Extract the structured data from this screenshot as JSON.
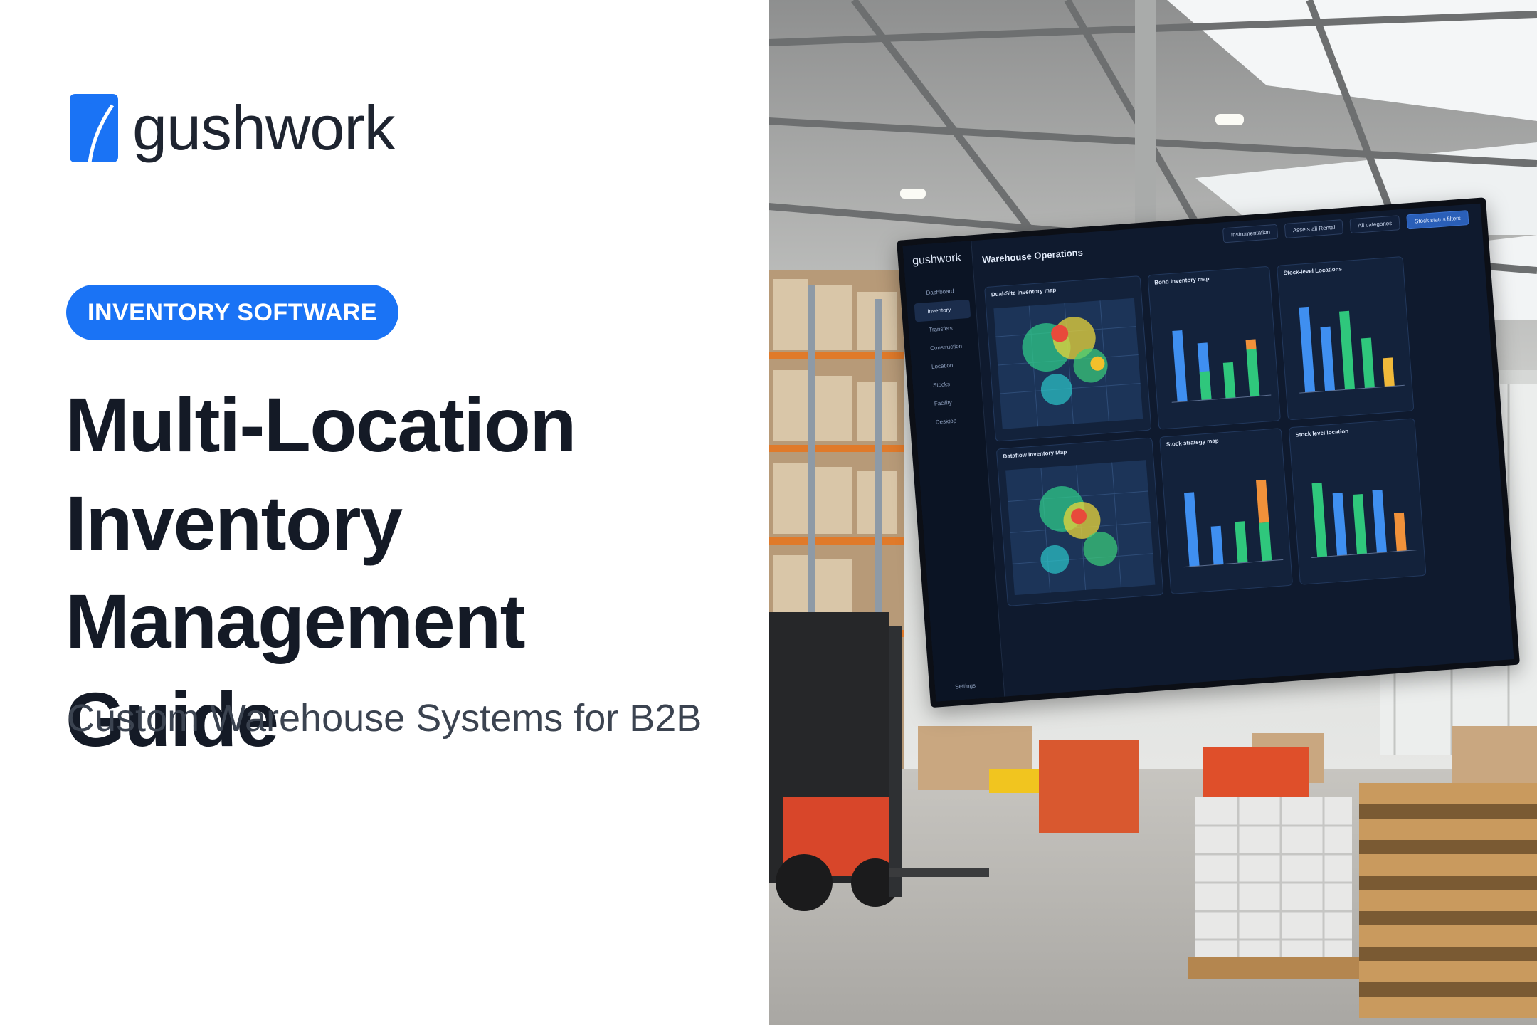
{
  "brand": {
    "name": "gushwork",
    "color": "#1a73f5"
  },
  "badge": {
    "label": "INVENTORY SOFTWARE"
  },
  "headline": {
    "line1": "Multi-Location",
    "line2": "Inventory",
    "line3": "Management Guide"
  },
  "subtitle": "Custom Warehouse Systems for B2B",
  "screen": {
    "logo": "gushwork",
    "title": "Warehouse Operations",
    "nav": [
      "Dashboard",
      "Inventory",
      "Transfers",
      "Construction",
      "Location",
      "Stocks",
      "Facility",
      "Desktop"
    ],
    "settings": "Settings",
    "top_pills": [
      "Instrumentation",
      "Assets all Rental",
      "All categories",
      "Stock status filters"
    ],
    "panels": [
      {
        "title": "Dual-Site Inventory map"
      },
      {
        "title": "Bond Inventory map"
      },
      {
        "title": "Stock-level Locations"
      },
      {
        "title": "Dataflow Inventory Map"
      },
      {
        "title": "Stock strategy map"
      },
      {
        "title": "Stock level location"
      }
    ]
  }
}
